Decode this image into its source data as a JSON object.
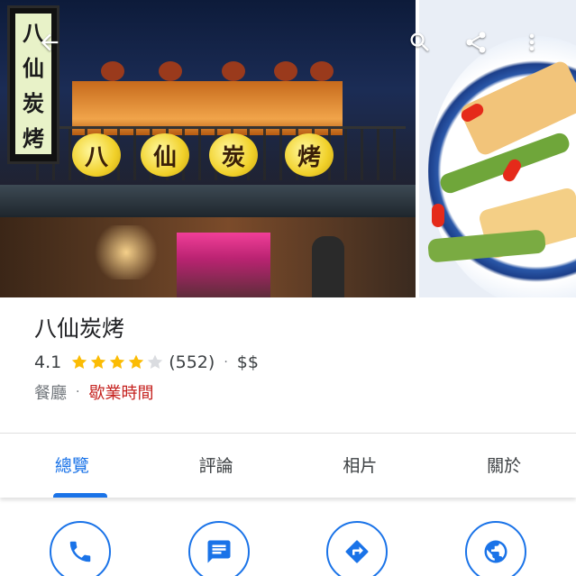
{
  "colors": {
    "accent": "#1a73e8",
    "star": "#fbbc04",
    "star_empty": "#dadce0",
    "hours": "#c5221f",
    "secondary": "#70757a"
  },
  "photo_header": {
    "sign_chars": [
      "八",
      "仙",
      "炭",
      "烤"
    ],
    "lantern_chars": [
      "八",
      "仙",
      "炭",
      "烤"
    ],
    "back_icon": "arrow-back-icon",
    "search_icon": "search-icon",
    "share_icon": "share-icon",
    "more_icon": "more-vert-icon"
  },
  "place": {
    "name": "八仙炭烤",
    "rating": "4.1",
    "rating_value": 4.1,
    "stars_total": 5,
    "review_count": "(552)",
    "separator": "·",
    "price": "$$",
    "category": "餐廳",
    "hours_label": "歇業時間"
  },
  "tabs": [
    {
      "label": "總覽",
      "active": true
    },
    {
      "label": "評論",
      "active": false
    },
    {
      "label": "相片",
      "active": false
    },
    {
      "label": "關於",
      "active": false
    }
  ],
  "actions": [
    {
      "icon": "phone-icon"
    },
    {
      "icon": "message-icon"
    },
    {
      "icon": "directions-icon"
    },
    {
      "icon": "website-icon"
    }
  ]
}
